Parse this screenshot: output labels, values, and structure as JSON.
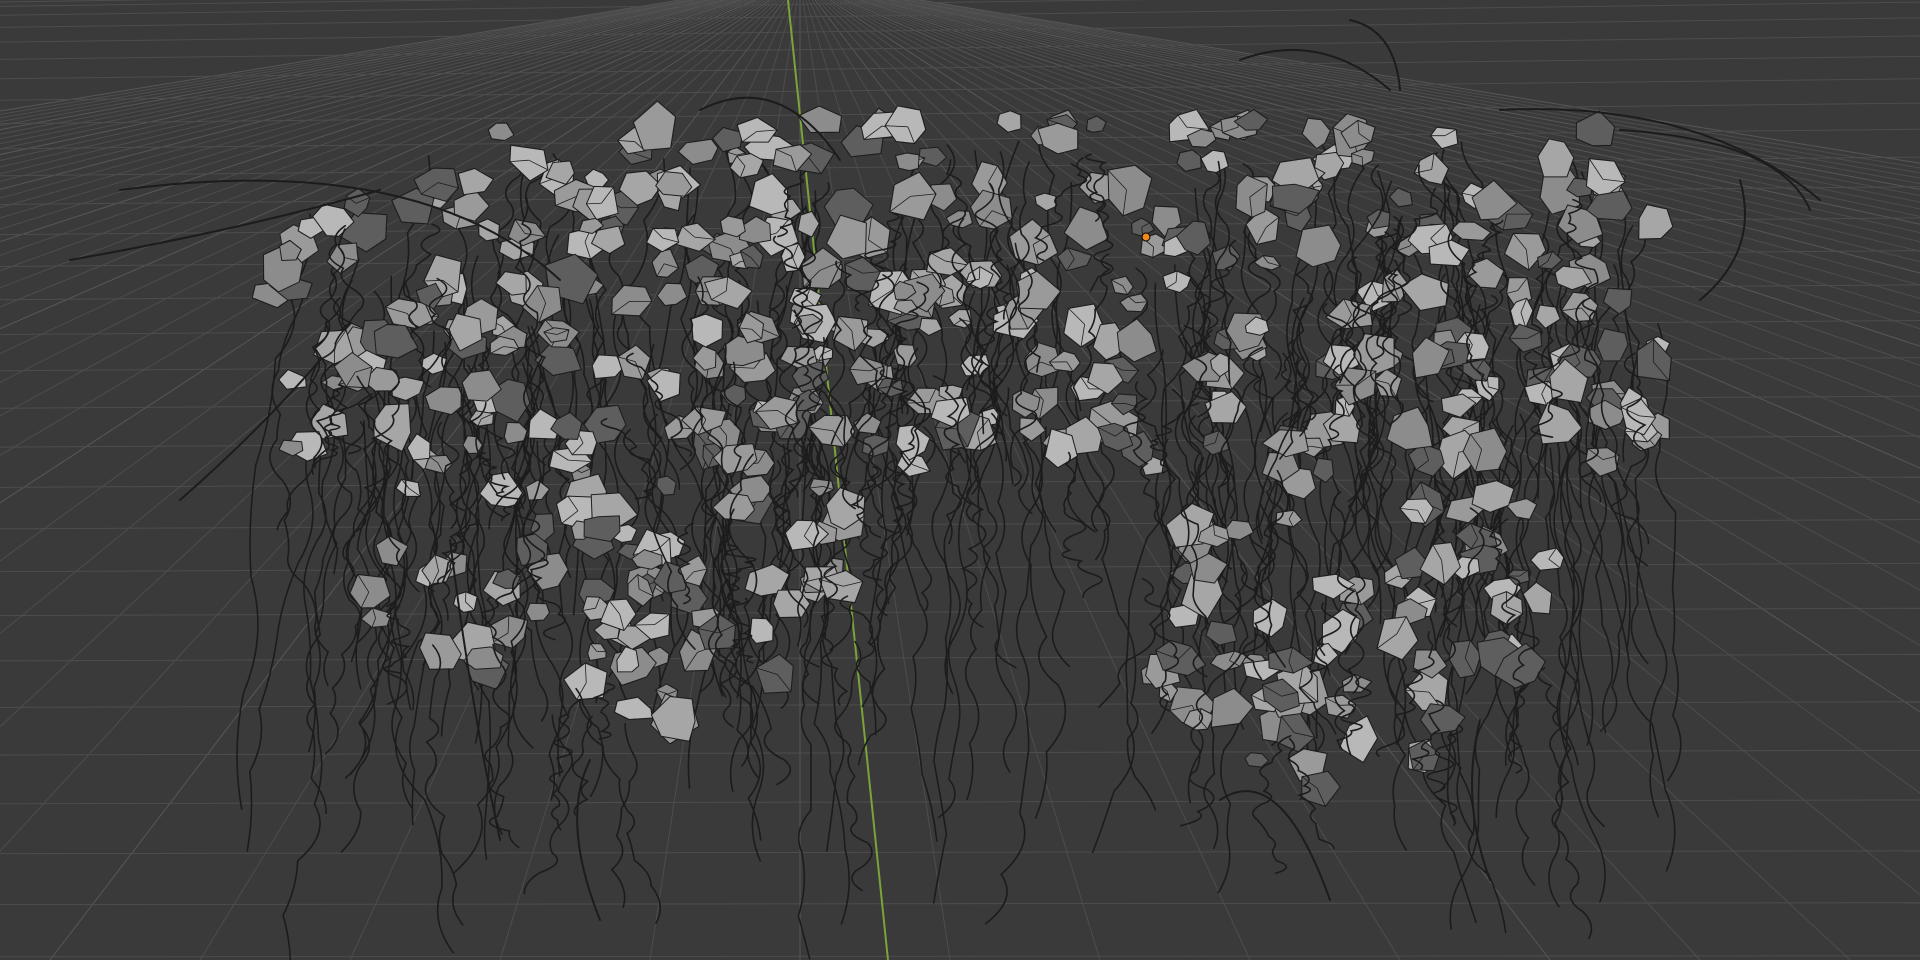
{
  "viewport": {
    "background_color": "#3a3a3a",
    "grid_line_color": "#4d4d4d",
    "grid_major_line_color": "#575757",
    "y_axis_color": "#7aa33a",
    "origin_marker_color": "#f08a1c"
  },
  "object": {
    "leaf_light_color": "#b8b8b8",
    "leaf_mid_color": "#8c8c8c",
    "leaf_dark_color": "#5e5e5e",
    "edge_color": "#1e1e1e",
    "vine_color": "#1c1c1c"
  },
  "icons": {
    "origin": "origin-dot-icon"
  }
}
